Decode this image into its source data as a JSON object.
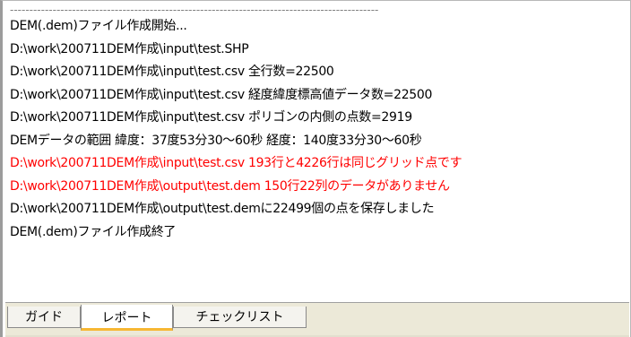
{
  "report": {
    "separator": "-----------------------------------------------------------------------------------------------",
    "lines": [
      {
        "text": "DEM(.dem)ファイル作成開始...",
        "type": "normal"
      },
      {
        "text": "D:\\work\\200711DEM作成\\input\\test.SHP",
        "type": "normal"
      },
      {
        "text": "D:\\work\\200711DEM作成\\input\\test.csv 全行数=22500",
        "type": "normal"
      },
      {
        "text": "D:\\work\\200711DEM作成\\input\\test.csv 経度緯度標高値データ数=22500",
        "type": "normal"
      },
      {
        "text": "D:\\work\\200711DEM作成\\input\\test.csv ポリゴンの内側の点数=2919",
        "type": "normal"
      },
      {
        "text": "DEMデータの範囲 緯度：37度53分30～60秒 経度：140度33分30～60秒",
        "type": "normal"
      },
      {
        "text": "D:\\work\\200711DEM作成\\input\\test.csv 193行と4226行は同じグリッド点です",
        "type": "error"
      },
      {
        "text": "D:\\work\\200711DEM作成\\output\\test.dem 150行22列のデータがありません",
        "type": "error"
      },
      {
        "text": "D:\\work\\200711DEM作成\\output\\test.demに22499個の点を保存しました",
        "type": "normal"
      },
      {
        "text": "DEM(.dem)ファイル作成終了",
        "type": "normal"
      }
    ]
  },
  "tabs": {
    "guide": "ガイド",
    "report": "レポート",
    "checklist": "チェックリスト",
    "active": "report"
  },
  "colors": {
    "error_text": "#ff0000",
    "normal_text": "#000000",
    "active_tab_underline": "#f7b733",
    "tabbar_background": "#ece9d8"
  }
}
